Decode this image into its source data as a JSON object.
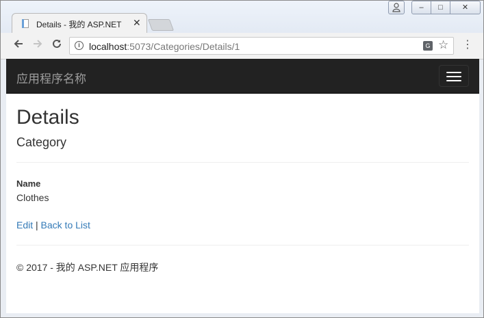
{
  "browser": {
    "tab": {
      "title": "Details - 我的 ASP.NET",
      "close_glyph": "✕"
    },
    "window_buttons": {
      "minimize": "–",
      "maximize": "□",
      "close": "✕"
    },
    "url": {
      "host": "localhost",
      "rest": ":5073/Categories/Details/1"
    }
  },
  "navbar": {
    "brand": "应用程序名称"
  },
  "page": {
    "title": "Details",
    "subtitle": "Category",
    "fields": [
      {
        "label": "Name",
        "value": "Clothes"
      }
    ],
    "actions": {
      "edit": "Edit",
      "separator": "|",
      "back": "Back to List"
    },
    "footer": "© 2017 - 我的 ASP.NET 应用程序"
  },
  "icons": [
    "favicon-icon",
    "user-icon",
    "back-arrow-icon",
    "forward-arrow-icon",
    "reload-icon",
    "info-icon",
    "translate-icon",
    "star-icon",
    "menu-dots-icon",
    "hamburger-icon"
  ],
  "colors": {
    "navbar_bg": "#222222",
    "brand_text": "#9d9d9d",
    "link": "#337ab7",
    "text": "#333333"
  }
}
